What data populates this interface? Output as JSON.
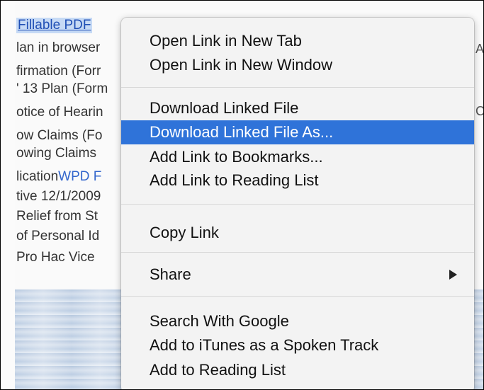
{
  "background": {
    "lines": [
      {
        "text": "Fillable PDF"
      },
      {
        "text": "lan in browser"
      },
      {
        "text": "firmation (Forr"
      },
      {
        "text": "' 13 Plan (Form"
      },
      {
        "text": "otice of Hearin"
      },
      {
        "text": "ow Claims (Fo"
      },
      {
        "text": "owing Claims"
      },
      {
        "text": "lication",
        "link": "WPD F"
      },
      {
        "text": "tive 12/1/2009"
      },
      {
        "text": "Relief from St"
      },
      {
        "text": "of Personal Id"
      },
      {
        "text": "Pro Hac Vice"
      }
    ],
    "edge_chars": [
      "A",
      "C"
    ]
  },
  "context_menu": {
    "groups": [
      [
        "Open Link in New Tab",
        "Open Link in New Window"
      ],
      [
        "Download Linked File",
        "Download Linked File As...",
        "Add Link to Bookmarks...",
        "Add Link to Reading List"
      ],
      [
        "Copy Link"
      ],
      [
        "Share"
      ],
      [
        "Search With Google",
        "Add to iTunes as a Spoken Track",
        "Add to Reading List"
      ]
    ],
    "highlighted_item": "Download Linked File As...",
    "highlight_color": "#2f73d9",
    "submenu_icon": "triangle-right-icon"
  }
}
